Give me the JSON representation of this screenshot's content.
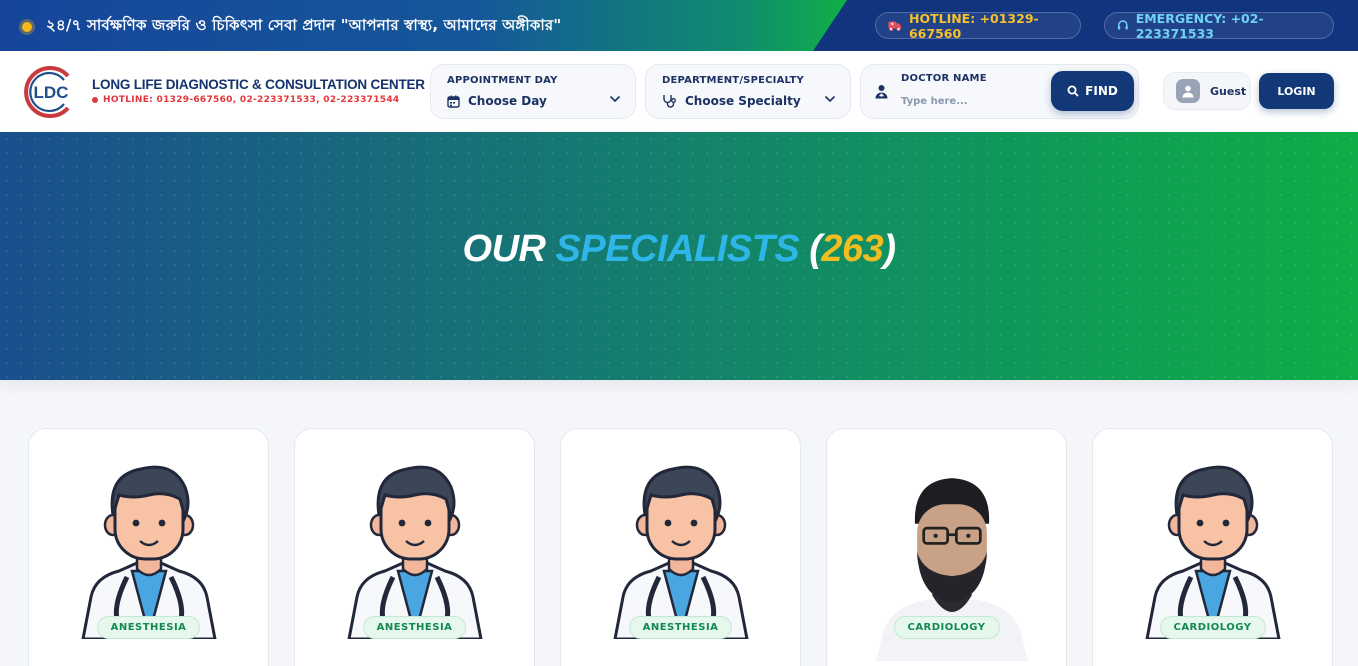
{
  "topbar": {
    "announcement": "২৪/৭ সার্বক্ষণিক জরুরি ও চিকিৎসা সেবা প্রদান \"আপনার স্বাস্থ্য, আমাদের অঙ্গীকার\"",
    "hotline": "HOTLINE: +01329-667560",
    "emergency": "EMERGENCY: +02-223371533"
  },
  "brand": {
    "logo_text": "LDC",
    "name": "LONG LIFE DIAGNOSTIC & CONSULTATION CENTER",
    "hotline": "HOTLINE: 01329-667560, 02-223371533, 02-223371544"
  },
  "search": {
    "day_label": "APPOINTMENT DAY",
    "day_value": "Choose Day",
    "dept_label": "DEPARTMENT/SPECIALTY",
    "dept_value": "Choose Specialty",
    "doctor_label": "DOCTOR NAME",
    "doctor_placeholder": "Type here...",
    "find_label": "FIND"
  },
  "user": {
    "guest_label": "Guest",
    "login_label": "LOGIN"
  },
  "hero": {
    "word1": "OUR",
    "word2": "SPECIALISTS",
    "open": "(",
    "count": "263",
    "close": ")"
  },
  "colors": {
    "navy": "#123878",
    "accent_blue": "#2eb6e8",
    "accent_gold": "#f2bd1f",
    "green": "#10ad48",
    "alert_red": "#e0363c"
  },
  "doctors": [
    {
      "department": "ANESTHESIA",
      "photo": "doctor-avatar-illustration"
    },
    {
      "department": "ANESTHESIA",
      "photo": "doctor-avatar-illustration"
    },
    {
      "department": "ANESTHESIA",
      "photo": "doctor-avatar-illustration"
    },
    {
      "department": "CARDIOLOGY",
      "photo": "doctor-photo"
    },
    {
      "department": "CARDIOLOGY",
      "photo": "doctor-avatar-illustration"
    }
  ]
}
